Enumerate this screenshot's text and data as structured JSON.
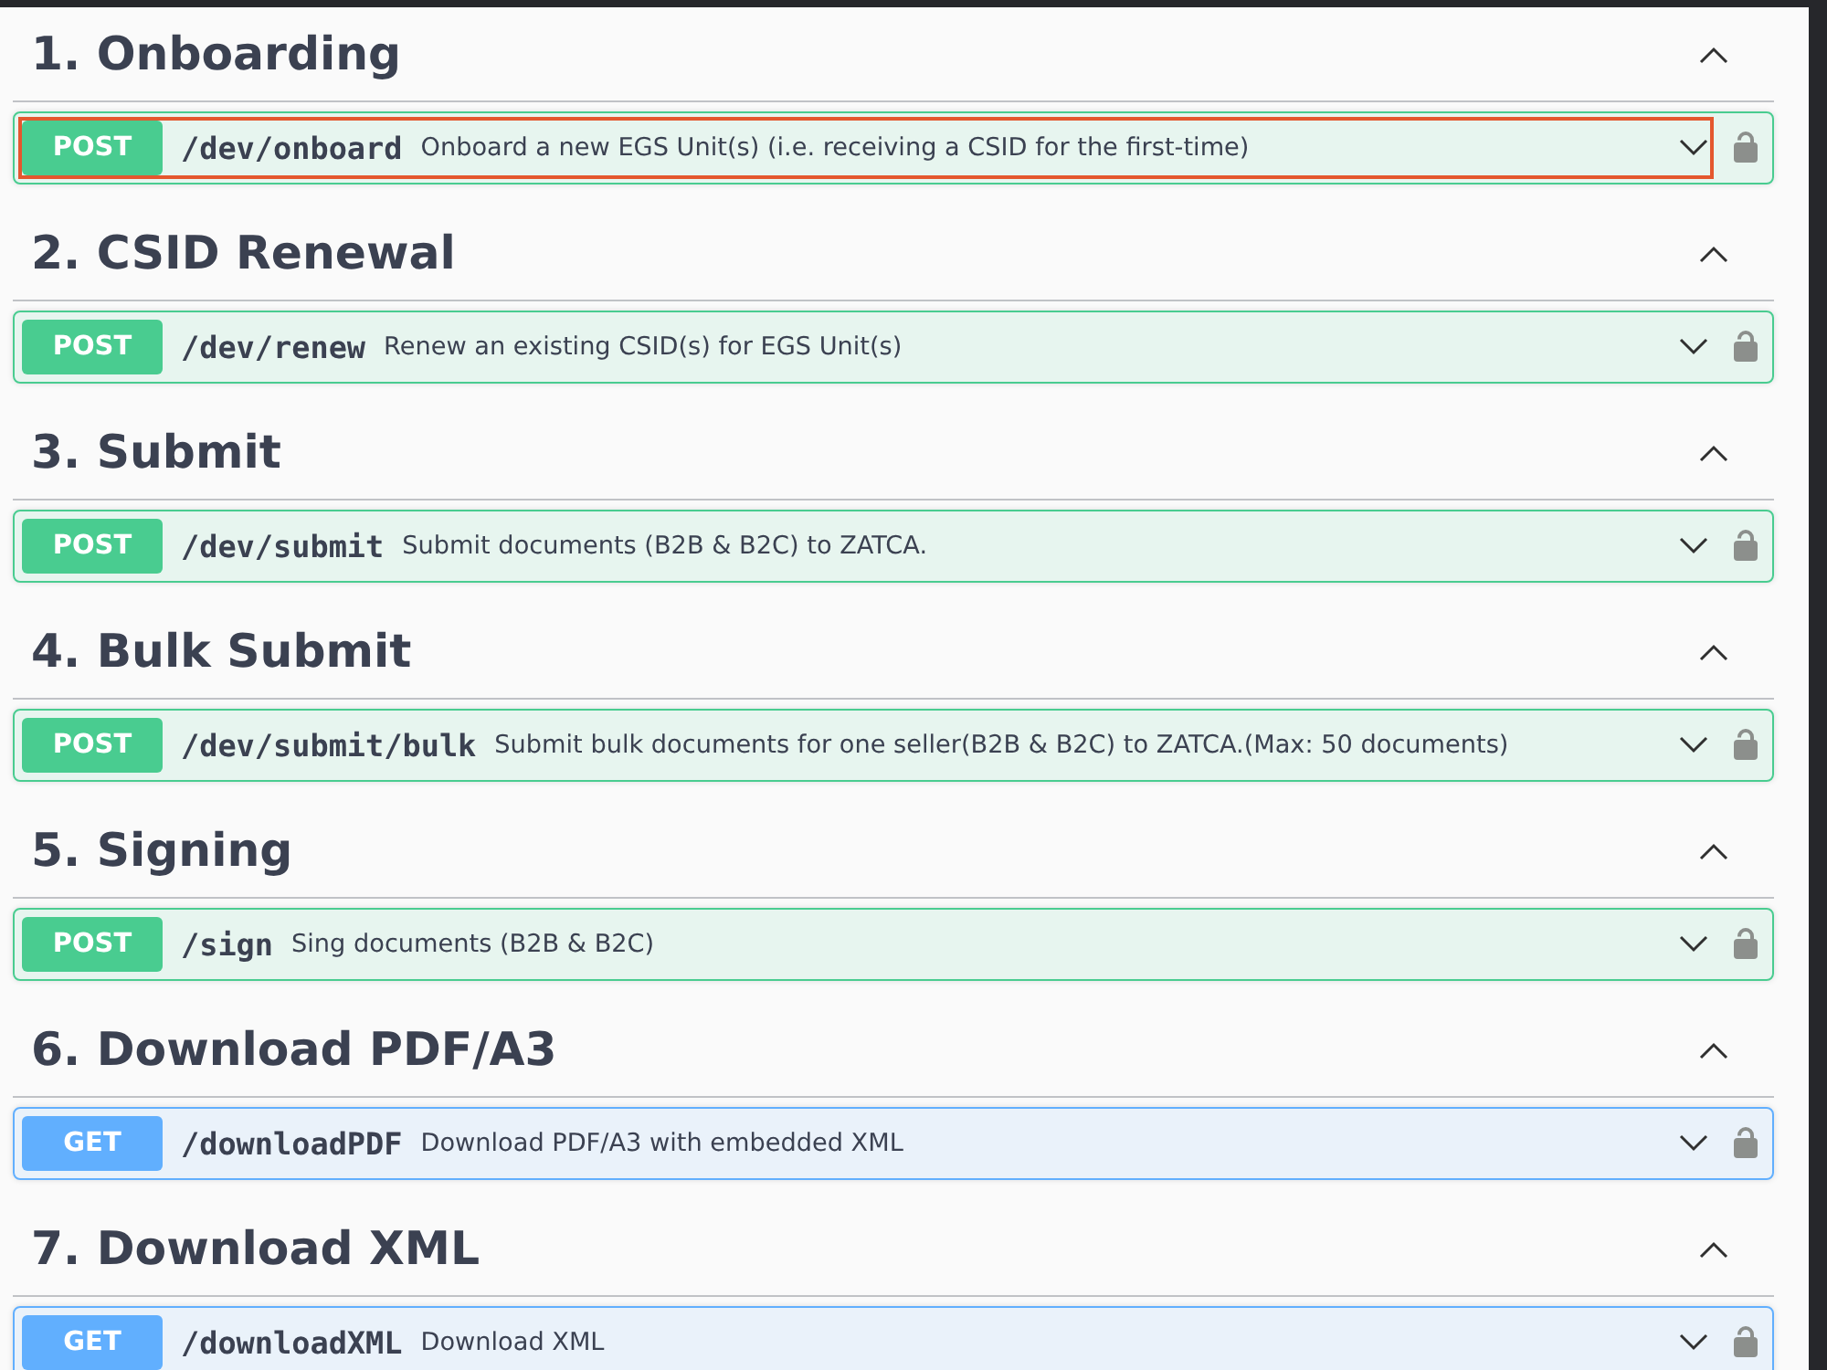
{
  "sections": [
    {
      "title": "1. Onboarding",
      "expanded": true,
      "operations": [
        {
          "method": "POST",
          "color": "#49cc90",
          "path": "/dev/onboard",
          "summary": "Onboard a new EGS Unit(s) (i.e. receiving a CSID for the first-time)",
          "focused": true,
          "expanded": false,
          "locked": false
        }
      ]
    },
    {
      "title": "2. CSID Renewal",
      "expanded": true,
      "operations": [
        {
          "method": "POST",
          "color": "#49cc90",
          "path": "/dev/renew",
          "summary": "Renew an existing CSID(s) for EGS Unit(s)",
          "focused": false,
          "expanded": false,
          "locked": false
        }
      ]
    },
    {
      "title": "3. Submit",
      "expanded": true,
      "operations": [
        {
          "method": "POST",
          "color": "#49cc90",
          "path": "/dev/submit",
          "summary": "Submit documents (B2B & B2C) to ZATCA.",
          "focused": false,
          "expanded": false,
          "locked": false
        }
      ]
    },
    {
      "title": "4. Bulk Submit",
      "expanded": true,
      "operations": [
        {
          "method": "POST",
          "color": "#49cc90",
          "path": "/dev/submit/bulk",
          "summary": "Submit bulk documents for one seller(B2B & B2C) to ZATCA.(Max: 50 documents)",
          "focused": false,
          "expanded": false,
          "locked": false
        }
      ]
    },
    {
      "title": "5. Signing",
      "expanded": true,
      "operations": [
        {
          "method": "POST",
          "color": "#49cc90",
          "path": "/sign",
          "summary": "Sing documents (B2B & B2C)",
          "focused": false,
          "expanded": false,
          "locked": false
        }
      ]
    },
    {
      "title": "6. Download PDF/A3",
      "expanded": true,
      "operations": [
        {
          "method": "GET",
          "color": "#61affe",
          "path": "/downloadPDF",
          "summary": "Download PDF/A3 with embedded XML",
          "focused": false,
          "expanded": false,
          "locked": false
        }
      ]
    },
    {
      "title": "7. Download XML",
      "expanded": true,
      "operations": [
        {
          "method": "GET",
          "color": "#61affe",
          "path": "/downloadXML",
          "summary": "Download XML",
          "focused": false,
          "expanded": false,
          "locked": false
        }
      ]
    }
  ]
}
